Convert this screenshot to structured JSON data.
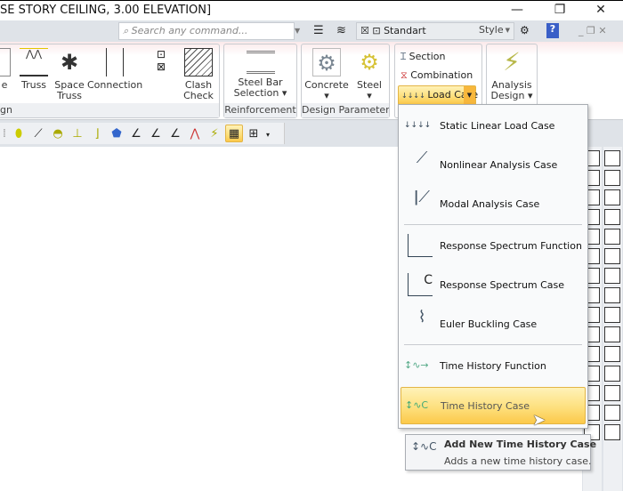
{
  "window": {
    "title": "SE STORY CEILING,  3.00 ELEVATION]",
    "minimize": "—",
    "restore": "❐",
    "close": "✕"
  },
  "quickbar": {
    "search_placeholder": "Search any command...",
    "style_combo": "Standart",
    "style_label": "Style",
    "help": "?"
  },
  "ribbon": {
    "groups": [
      {
        "label": "gn",
        "buttons": [
          "e",
          "Truss",
          "Space Truss",
          "Connection",
          "Clash Check"
        ]
      },
      {
        "label": "Reinforcement",
        "buttons": [
          "Steel Bar Selection"
        ]
      },
      {
        "label": "Design Parameters",
        "buttons": [
          "Concrete",
          "Steel"
        ]
      },
      {
        "label": "",
        "buttons": [
          "Section",
          "Combination",
          "Load Case"
        ]
      },
      {
        "label": "",
        "buttons": [
          "Analysis Design"
        ]
      }
    ]
  },
  "menu": {
    "items": [
      {
        "label": "Static Linear Load Case",
        "icon": "static-load-icon"
      },
      {
        "label": "Nonlinear Analysis Case",
        "icon": "nonlinear-icon"
      },
      {
        "label": "Modal Analysis Case",
        "icon": "modal-icon"
      },
      {
        "label": "Response Spectrum Function",
        "icon": "spectrum-function-icon"
      },
      {
        "label": "Response Spectrum Case",
        "icon": "spectrum-case-icon"
      },
      {
        "label": "Euler Buckling Case",
        "icon": "buckling-icon"
      },
      {
        "label": "Time History Function",
        "icon": "time-history-function-icon"
      },
      {
        "label": "Time History Case",
        "icon": "time-history-case-icon",
        "highlighted": true
      }
    ]
  },
  "tooltip": {
    "title": "Add New Time History Case",
    "description": "Adds a new time history case."
  },
  "colors": {
    "highlight": "#fcd55e",
    "ribbon_tint": "#fbe9ea",
    "chrome": "#dfe3e8"
  }
}
